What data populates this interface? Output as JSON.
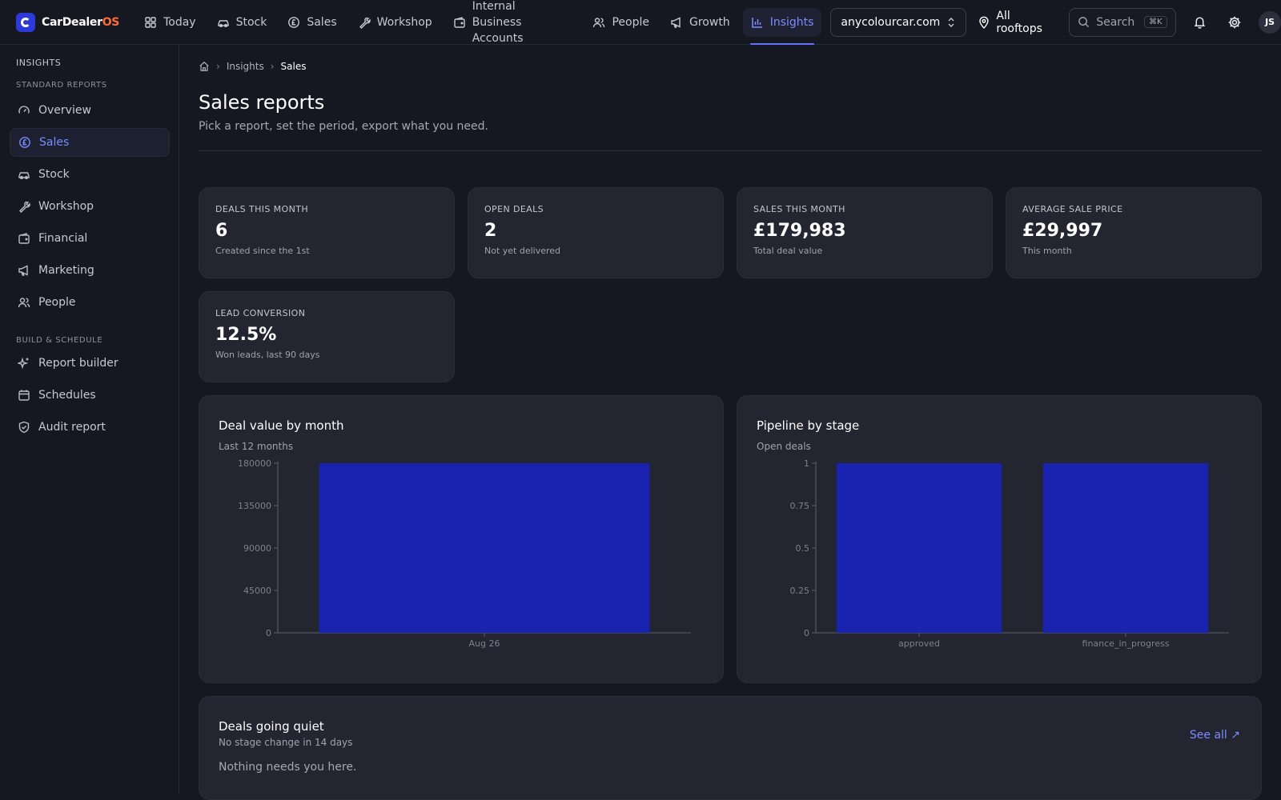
{
  "app": {
    "name_main": "CarDealer",
    "name_accent": "OS"
  },
  "nav": {
    "items": [
      {
        "label": "Today",
        "icon": "grid-icon"
      },
      {
        "label": "Stock",
        "icon": "car-icon"
      },
      {
        "label": "Sales",
        "icon": "pound-circle-icon"
      },
      {
        "label": "Workshop",
        "icon": "wrench-icon"
      },
      {
        "label_line1": "Internal Business",
        "label_line2": "Accounts",
        "icon": "wallet-icon"
      },
      {
        "label": "People",
        "icon": "people-icon"
      },
      {
        "label": "Growth",
        "icon": "megaphone-icon"
      },
      {
        "label": "Insights",
        "icon": "bar-chart-icon",
        "active": true
      }
    ],
    "domain": "anycolourcar.com",
    "rooftops": "All rooftops",
    "search_label": "Search",
    "search_kbd": "⌘K",
    "avatar_initials": "JS"
  },
  "sidebar": {
    "title": "INSIGHTS",
    "section1": "STANDARD REPORTS",
    "items1": [
      {
        "label": "Overview"
      },
      {
        "label": "Sales",
        "active": true
      },
      {
        "label": "Stock"
      },
      {
        "label": "Workshop"
      },
      {
        "label": "Financial"
      },
      {
        "label": "Marketing"
      },
      {
        "label": "People"
      }
    ],
    "section2": "BUILD & SCHEDULE",
    "items2": [
      {
        "label": "Report builder"
      },
      {
        "label": "Schedules"
      },
      {
        "label": "Audit report"
      }
    ]
  },
  "breadcrumb": {
    "parent": "Insights",
    "current": "Sales"
  },
  "page": {
    "title": "Sales reports",
    "subtitle": "Pick a report, set the period, export what you need."
  },
  "kpis": [
    {
      "label": "DEALS THIS MONTH",
      "value": "6",
      "note": "Created since the 1st"
    },
    {
      "label": "OPEN DEALS",
      "value": "2",
      "note": "Not yet delivered"
    },
    {
      "label": "SALES THIS MONTH",
      "value": "£179,983",
      "note": "Total deal value"
    },
    {
      "label": "AVERAGE SALE PRICE",
      "value": "£29,997",
      "note": "This month"
    },
    {
      "label": "LEAD CONVERSION",
      "value": "12.5%",
      "note": "Won leads, last 90 days"
    }
  ],
  "chart_data": [
    {
      "type": "bar",
      "title": "Deal value by month",
      "subtitle": "Last 12 months",
      "categories": [
        "Aug 26"
      ],
      "values": [
        179983
      ],
      "ylim": [
        0,
        180000
      ],
      "yticks": [
        0,
        45000,
        90000,
        135000,
        180000
      ],
      "bar_color": "#1a22b0",
      "grid": false
    },
    {
      "type": "bar",
      "title": "Pipeline by stage",
      "subtitle": "Open deals",
      "categories": [
        "approved",
        "finance_in_progress"
      ],
      "values": [
        1,
        1
      ],
      "ylim": [
        0,
        1
      ],
      "yticks": [
        0,
        0.25,
        0.5,
        0.75,
        1
      ],
      "bar_color": "#1a22b0",
      "grid": false
    }
  ],
  "quiet": {
    "title": "Deals going quiet",
    "subtitle": "No stage change in 14 days",
    "empty": "Nothing needs you here.",
    "see_all": "See all ↗"
  }
}
